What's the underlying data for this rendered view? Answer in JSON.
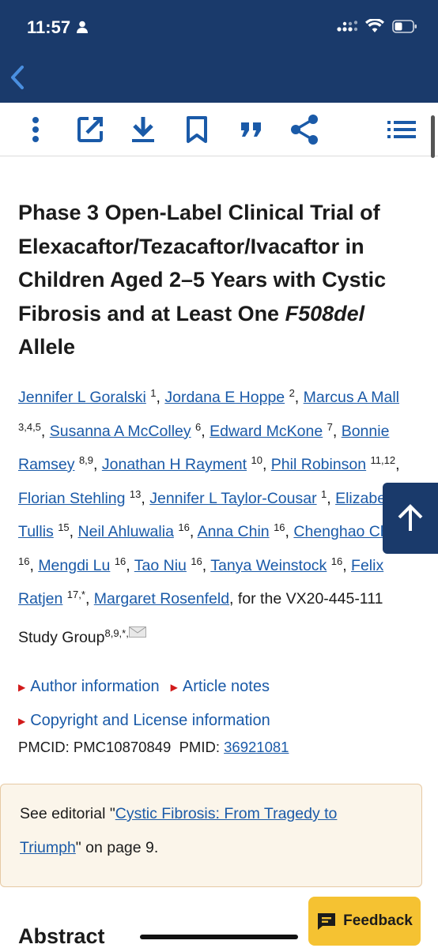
{
  "status_bar": {
    "time": "11:57"
  },
  "toolbar": {
    "icons": [
      "more-vertical-icon",
      "open-external-icon",
      "download-icon",
      "bookmark-icon",
      "cite-quote-icon",
      "share-icon",
      "contents-list-icon"
    ]
  },
  "article": {
    "title_main": "Phase 3 Open-Label Clinical Trial of Elexacaftor/Tezacaftor/Ivacaftor in Children Aged 2–5 Years with Cystic Fibrosis and at Least One ",
    "title_italic": "F508del",
    "title_end": "Allele",
    "authors": [
      {
        "name": "Jennifer L Goralski",
        "sup": "1"
      },
      {
        "name": "Jordana E Hoppe",
        "sup": "2"
      },
      {
        "name": "Marcus A Mall",
        "sup": "3,4,5"
      },
      {
        "name": "Susanna A McColley",
        "sup": "6"
      },
      {
        "name": "Edward McKone",
        "sup": "7"
      },
      {
        "name": "Bonnie Ramsey",
        "sup": "8,9"
      },
      {
        "name": "Jonathan H Rayment",
        "sup": "10"
      },
      {
        "name": "Phil Robinson",
        "sup": "11,12"
      },
      {
        "name": "Florian Stehling",
        "sup": "13"
      },
      {
        "name": "Jennifer L Taylor-Cousar",
        "sup": "1"
      },
      {
        "name": "Elizabeth Tullis",
        "sup": "15"
      },
      {
        "name": "Neil Ahluwalia",
        "sup": "16"
      },
      {
        "name": "Anna Chin",
        "sup": "16"
      },
      {
        "name": "Chenghao Chu",
        "sup": "16"
      },
      {
        "name": "Mengdi Lu",
        "sup": "16"
      },
      {
        "name": "Tao Niu",
        "sup": "16"
      },
      {
        "name": "Tanya Weinstock",
        "sup": "16"
      },
      {
        "name": "Felix Ratjen",
        "sup": "17,*"
      },
      {
        "name": "Margaret Rosenfeld",
        "sup": ""
      }
    ],
    "study_group_prefix": ", for the VX20-445-111 Study Group",
    "study_group_sup": "8,9,*,",
    "author_info_label": "Author information",
    "article_notes_label": "Article notes",
    "copyright_label": "Copyright and License information",
    "pmcid_label": "PMCID:",
    "pmcid": "PMC10870849",
    "pmid_label": "PMID:",
    "pmid": "36921081",
    "editorial_prefix": "See editorial \"",
    "editorial_link": "Cystic Fibrosis: From Tragedy to Triumph",
    "editorial_suffix": "\" on page 9.",
    "abstract_heading": "Abstract"
  },
  "feedback_label": "Feedback",
  "colors": {
    "header": "#1a3a6b",
    "link": "#1a5aa8",
    "feedback": "#f5c232",
    "triangle": "#d11a1a",
    "editorial_bg": "#fbf5ea"
  }
}
